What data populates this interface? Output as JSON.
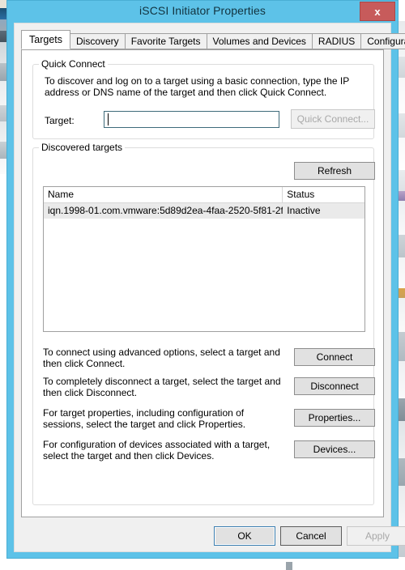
{
  "window": {
    "title": "iSCSI Initiator Properties",
    "close_label": "x",
    "close_icon": "close-icon"
  },
  "tabs": [
    {
      "label": "Targets",
      "active": true
    },
    {
      "label": "Discovery",
      "active": false
    },
    {
      "label": "Favorite Targets",
      "active": false
    },
    {
      "label": "Volumes and Devices",
      "active": false
    },
    {
      "label": "RADIUS",
      "active": false
    },
    {
      "label": "Configuration",
      "active": false
    }
  ],
  "quick_connect": {
    "group_title": "Quick Connect",
    "description": "To discover and log on to a target using a basic connection, type the IP address or DNS name of the target and then click Quick Connect.",
    "target_label": "Target:",
    "target_value": "",
    "target_placeholder": "",
    "button_label": "Quick Connect...",
    "button_enabled": false
  },
  "discovered_targets": {
    "group_title": "Discovered targets",
    "refresh_label": "Refresh",
    "columns": [
      "Name",
      "Status"
    ],
    "rows": [
      {
        "name": "iqn.1998-01.com.vmware:5d89d2ea-4faa-2520-5f81-2f...",
        "status": "Inactive"
      }
    ],
    "actions": [
      {
        "text": "To connect using advanced options, select a target and then click Connect.",
        "button": "Connect"
      },
      {
        "text": "To completely disconnect a target, select the target and then click Disconnect.",
        "button": "Disconnect"
      },
      {
        "text": "For target properties, including configuration of sessions, select the target and click Properties.",
        "button": "Properties..."
      },
      {
        "text": "For configuration of devices associated with a target, select the target and then click Devices.",
        "button": "Devices..."
      }
    ]
  },
  "footer": {
    "ok_label": "OK",
    "cancel_label": "Cancel",
    "apply_label": "Apply",
    "apply_enabled": false
  },
  "colors": {
    "titlebar": "#5dc2e8",
    "close_button": "#c75b5b",
    "client_background": "#f0f0f0",
    "page_background": "#ffffff",
    "focus_border": "#3f6b7a",
    "default_button_border": "#3c7fb1",
    "row_selected": "#eaeaea"
  }
}
